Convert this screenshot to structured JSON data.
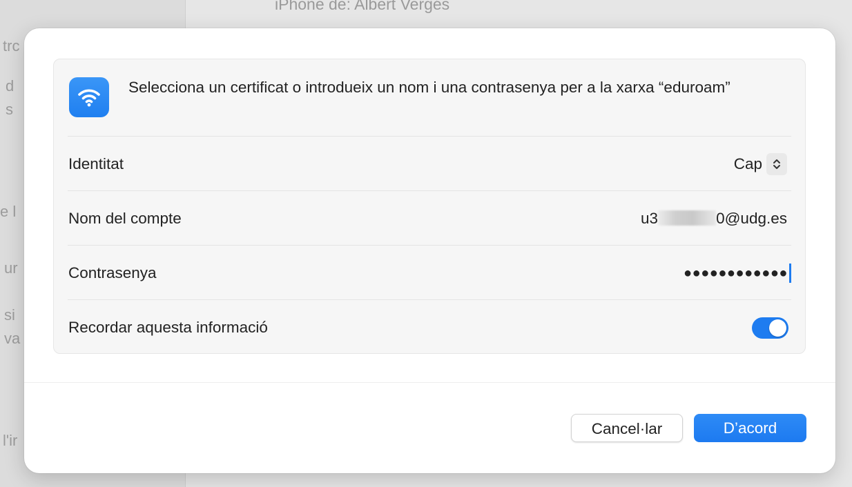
{
  "background": {
    "window_title": "iPhone de: Albert Vergés",
    "sidebar_fragments": [
      "trc",
      "d",
      "s",
      "e l",
      "ur",
      "si",
      "va",
      "l'ir"
    ]
  },
  "dialog": {
    "icon": "wifi-icon",
    "prompt": "Selecciona un certificat o introdueix un nom i una contrasenya per a la xarxa “eduroam”",
    "identity": {
      "label": "Identitat",
      "value": "Cap"
    },
    "account": {
      "label": "Nom del compte",
      "value_prefix": "u3",
      "value_suffix": "0@udg.es"
    },
    "password": {
      "label": "Contrasenya",
      "masked_value": "●●●●●●●●●●●●"
    },
    "remember": {
      "label": "Recordar aquesta informació",
      "enabled": true
    },
    "buttons": {
      "cancel": "Cancel·lar",
      "ok": "D’acord"
    }
  },
  "colors": {
    "accent": "#1e7cf0",
    "dialog_bg": "#ffffff",
    "group_bg": "#f6f6f6"
  }
}
